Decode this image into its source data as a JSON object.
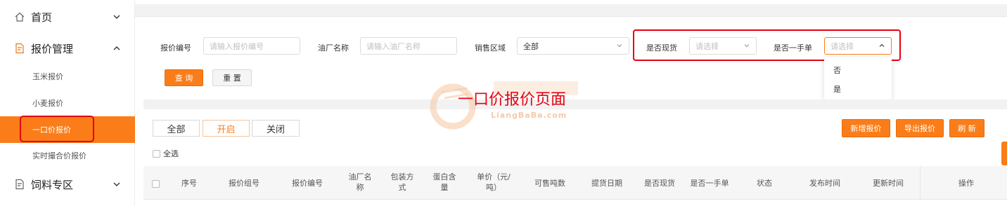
{
  "sidebar": {
    "items": [
      {
        "label": "首页",
        "icon": "home-icon",
        "expanded": false
      },
      {
        "label": "报价管理",
        "icon": "document-icon",
        "expanded": true
      },
      {
        "label": "饲料专区",
        "icon": "document-icon",
        "expanded": false
      }
    ],
    "submenu": [
      {
        "label": "玉米报价"
      },
      {
        "label": "小麦报价"
      },
      {
        "label": "一口价报价",
        "active": true
      },
      {
        "label": "实时撮合价报价"
      }
    ]
  },
  "filters": {
    "quote_no": {
      "label": "报价编号",
      "placeholder": "请输入报价编号"
    },
    "mill_name": {
      "label": "油厂名称",
      "placeholder": "请输入油厂名称"
    },
    "region": {
      "label": "销售区域",
      "value": "全部"
    },
    "spot": {
      "label": "是否现货",
      "placeholder": "请选择"
    },
    "first_hand": {
      "label": "是否一手单",
      "placeholder": "请选择"
    },
    "first_hand_options": [
      "否",
      "是"
    ],
    "query_label": "查 询",
    "reset_label": "重 置"
  },
  "annotation": {
    "title": "一口价报价页面",
    "watermark_text": "LiangBaBa.com"
  },
  "status_tabs": [
    "全部",
    "开启",
    "关闭"
  ],
  "selected_status_tab": "开启",
  "actions": {
    "add": "新增报价",
    "export": "导出报价",
    "refresh": "刷 新"
  },
  "select_all_label": "全选",
  "table": {
    "columns": [
      "序号",
      "报价组号",
      "报价编号",
      "油厂名称",
      "包装方式",
      "蛋白含量",
      "单价（元/吨）",
      "可售吨数",
      "提货日期",
      "是否现货",
      "是否一手单",
      "状态",
      "发布时间",
      "更新时间",
      "操作"
    ]
  },
  "colors": {
    "accent": "#fa7d19",
    "annotation_red": "#e60012"
  }
}
